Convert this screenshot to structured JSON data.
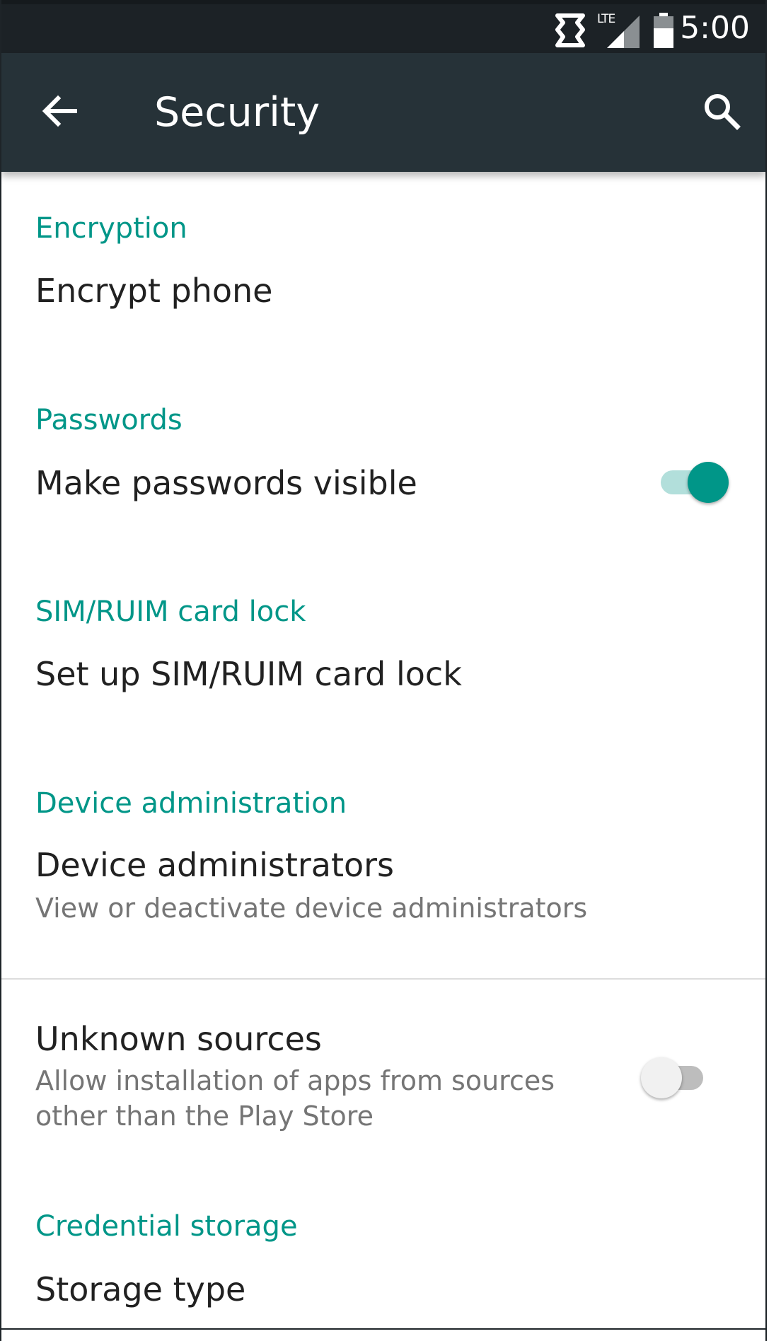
{
  "status_bar": {
    "time": "5:00",
    "network_label": "LTE",
    "icons": [
      "sync-icon",
      "lte-signal-icon",
      "battery-icon"
    ]
  },
  "app_bar": {
    "title": "Security",
    "back_icon": "arrow-back-icon",
    "search_icon": "search-icon"
  },
  "sections": [
    {
      "category": "Encryption",
      "items": [
        {
          "title": "Encrypt phone"
        }
      ]
    },
    {
      "category": "Passwords",
      "items": [
        {
          "title": "Make passwords visible",
          "switch": true
        }
      ]
    },
    {
      "category": "SIM/RUIM card lock",
      "items": [
        {
          "title": "Set up SIM/RUIM card lock"
        }
      ]
    },
    {
      "category": "Device administration",
      "items": [
        {
          "title": "Device administrators",
          "summary": "View or deactivate device administrators"
        },
        {
          "title": "Unknown sources",
          "summary_line1": "Allow installation of apps from sources",
          "summary_line2": "other than the Play Store",
          "switch": false
        }
      ]
    },
    {
      "category": "Credential storage",
      "items": [
        {
          "title": "Storage type"
        }
      ]
    }
  ],
  "colors": {
    "status_bar": "#1c2226",
    "app_bar": "#263238",
    "accent": "#009688",
    "title_text": "#212121",
    "summary_text": "#757575"
  }
}
